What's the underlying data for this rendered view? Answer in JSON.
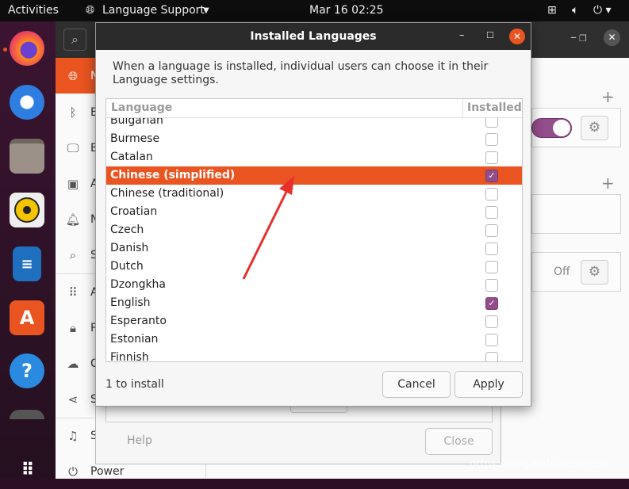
{
  "topbar": {
    "activities": "Activities",
    "app_menu": "Language Support",
    "clock": "Mar 16  02:25"
  },
  "dock": {
    "items": [
      "firefox",
      "thunderbird",
      "files",
      "rhythmbox",
      "libreoffice-writer",
      "ubuntu-software",
      "help",
      "unknown-app",
      "show-applications"
    ]
  },
  "sidebar": {
    "items": [
      {
        "label": "N",
        "icon": "globe"
      },
      {
        "label": "B",
        "icon": "bluetooth"
      },
      {
        "label": "B",
        "icon": "background"
      },
      {
        "label": "A",
        "icon": "appearance"
      },
      {
        "label": "N",
        "icon": "bell"
      },
      {
        "label": "S",
        "icon": "search"
      },
      {
        "label": "A",
        "icon": "apps-grid"
      },
      {
        "label": "P",
        "icon": "lock"
      },
      {
        "label": "C",
        "icon": "cloud"
      },
      {
        "label": "S",
        "icon": "share"
      },
      {
        "label": "S",
        "icon": "music-note"
      },
      {
        "label": "Power",
        "icon": "power"
      }
    ]
  },
  "content": {
    "off_label": "Off",
    "toggle_on": true
  },
  "background_window": {
    "help": "Help",
    "close": "Close"
  },
  "dialog": {
    "title": "Installed Languages",
    "description": "When a language is installed, individual users can choose it in their Language settings.",
    "columns": {
      "language": "Language",
      "installed": "Installed"
    },
    "rows": [
      {
        "name": "Bulgarian",
        "installed": false
      },
      {
        "name": "Burmese",
        "installed": false
      },
      {
        "name": "Catalan",
        "installed": false
      },
      {
        "name": "Chinese (simplified)",
        "installed": true,
        "selected": true
      },
      {
        "name": "Chinese (traditional)",
        "installed": false
      },
      {
        "name": "Croatian",
        "installed": false
      },
      {
        "name": "Czech",
        "installed": false
      },
      {
        "name": "Danish",
        "installed": false
      },
      {
        "name": "Dutch",
        "installed": false
      },
      {
        "name": "Dzongkha",
        "installed": false
      },
      {
        "name": "English",
        "installed": true
      },
      {
        "name": "Esperanto",
        "installed": false
      },
      {
        "name": "Estonian",
        "installed": false
      },
      {
        "name": "Finnish",
        "installed": false
      }
    ],
    "status": "1 to install",
    "cancel": "Cancel",
    "apply": "Apply"
  },
  "watermark": "https://blog.csdn.net/Alece",
  "colors": {
    "accent": "#e95420",
    "check": "#924d8b",
    "annotation_arrow": "#e8302a"
  }
}
